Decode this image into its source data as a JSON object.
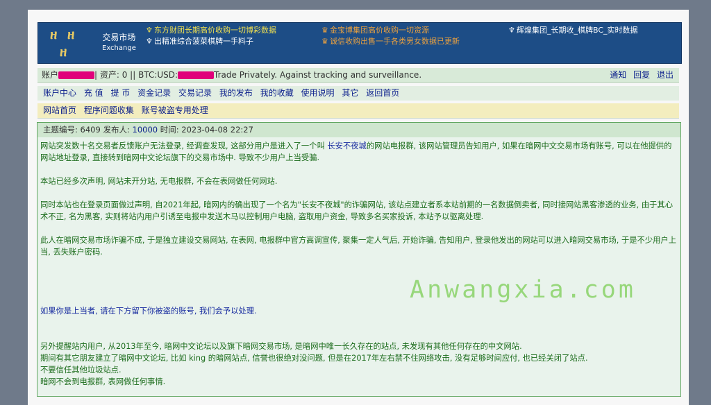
{
  "banner": {
    "logo_text_top": "ዘ ዘ",
    "logo_text_bottom": "ዘ",
    "market_cn": "交易市场",
    "market_en": "Exchange",
    "ads": [
      {
        "icon": "♆",
        "text": "东方财团长期高价收购一切博彩数据"
      },
      {
        "icon": "♆",
        "text": "出精准综合菠菜棋牌一手料子"
      },
      {
        "icon": "♛",
        "text": "金宝博集团高价收购一切资源"
      },
      {
        "icon": "♛",
        "text": "诚信收购出售一手各类男女数据已更新"
      },
      {
        "icon": "♆",
        "text": "辉煌集团_长期收_棋牌BC_实时数据"
      }
    ]
  },
  "account": {
    "label": "账户",
    "sep1": "| 资产: 0 || BTC:USD:",
    "tagline": "Trade Privately. Against tracking and surveillance.",
    "links": [
      "通知",
      "回复",
      "退出"
    ]
  },
  "nav_main": [
    "账户中心",
    "充 值",
    "提 币",
    "资金记录",
    "交易记录",
    "我的发布",
    "我的收藏",
    "使用说明",
    "其它",
    "返回首页"
  ],
  "nav_sub": [
    "网站首页",
    "程序问题收集",
    "账号被盗专用处理"
  ],
  "post": {
    "topic_label": "主题编号: ",
    "topic_id": "6409",
    "publisher_label": " 发布人: ",
    "publisher": "10000",
    "time_label": " 时间: ",
    "time": "2023-04-08 22:27",
    "p1_a": "网站突发数十名交易者反馈账户无法登录, 经调查发现, 这部分用户是进入了一个叫 ",
    "p1_link": "长安不夜城",
    "p1_b": "的网站电报群, 该网站管理员告知用户, 如果在暗网中文交易市场有账号, 可以在他提供的网站地址登录, 直接转到暗网中文论坛旗下的交易市场中. 导致不少用户上当受骗.",
    "p2": "本站已经多次声明, 网站未开分站, 无电报群, 不会在表网做任何网站.",
    "p3": "同时本站也在登录页面做过声明, 自2021年起, 暗网内的确出现了一个名为\"长安不夜城\"的诈骗网站, 该站点建立者系本站前期的一名数据倒卖者, 同时接网站黑客渗透的业务, 由于其心术不正, 名为黑客, 实则将站内用户引诱至电报中发送木马以控制用户电脑, 盗取用户资金, 导致多名买家投诉, 本站予以驱离处理.",
    "p4": "此人在暗网交易市场诈骗不成, 于是独立建设交易网站, 在表网, 电报群中官方高调宣传, 聚集一定人气后, 开始诈骗, 告知用户, 登录他发出的网站可以进入暗网交易市场, 于是不少用户上当, 丢失账户密码.",
    "p5": "如果你是上当者, 请在下方留下你被盗的账号, 我们会予以处理.",
    "p6_1": "另外提醒站内用户, 从2013年至今, 暗网中文论坛以及旗下暗网交易市场, 是暗网中唯一长久存在的站点, 未发现有其他任何存在的中文网站.",
    "p6_2": "期间有其它朋友建立了暗网中文论坛, 比如 king 的暗网站点, 信誉也很绝对没问题, 但是在2017年左右禁不住网络攻击, 没有足够时间应付, 也已经关闭了站点.",
    "p6_3": "不要信任其他垃圾站点.",
    "p6_4": "暗网不会到电报群, 表网做任何事情."
  },
  "watermark": "Anwangxia.com"
}
